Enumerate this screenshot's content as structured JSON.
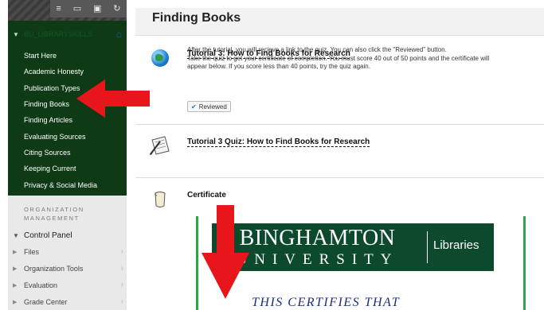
{
  "sidebar": {
    "tools": [
      "≡",
      "▭",
      "▣",
      "↻"
    ],
    "course_title": "BU_LIBRARYSKILLS",
    "home_icon": "home-icon",
    "items": [
      {
        "label": "Start Here"
      },
      {
        "label": "Academic Honesty"
      },
      {
        "label": "Publication Types"
      },
      {
        "label": "Finding Books"
      },
      {
        "label": "Finding Articles"
      },
      {
        "label": "Evaluating Sources"
      },
      {
        "label": "Citing Sources"
      },
      {
        "label": "Keeping Current"
      },
      {
        "label": "Privacy & Social Media"
      }
    ],
    "org_heading_1": "ORGANIZATION",
    "org_heading_2": "MANAGEMENT",
    "control_panel": "Control Panel",
    "control_items": [
      {
        "label": "Files"
      },
      {
        "label": "Organization Tools"
      },
      {
        "label": "Evaluation"
      },
      {
        "label": "Grade Center"
      }
    ]
  },
  "main": {
    "page_title": "Finding Books",
    "tutorial": {
      "title": "Tutorial 3: How to Find Books for Research",
      "desc_line1": "After the tutorial, you will recieve a link to the quiz. You can also click the \"Reviewed\" button.",
      "desc_line2": "Take the quiz to get your certificate of completion.   You must score 40 out of 50 points and the certificate will",
      "desc_line3": "appear below. If you score less than 40 points, try the quiz again.",
      "reviewed_label": "Reviewed"
    },
    "quiz": {
      "title": "Tutorial 3 Quiz: How to Find Books for Research"
    },
    "certificate": {
      "title": "Certificate",
      "line1": "BINGHAMTON",
      "line2": "UNIVERSITY",
      "libraries": "Libraries",
      "certifies": "THIS CERTIFIES THAT"
    }
  },
  "colors": {
    "menu_bg": "#0e3a16",
    "banner_bg": "#0d4a2d",
    "arrow_red": "#e8161b",
    "cert_border": "#2fa54a"
  }
}
